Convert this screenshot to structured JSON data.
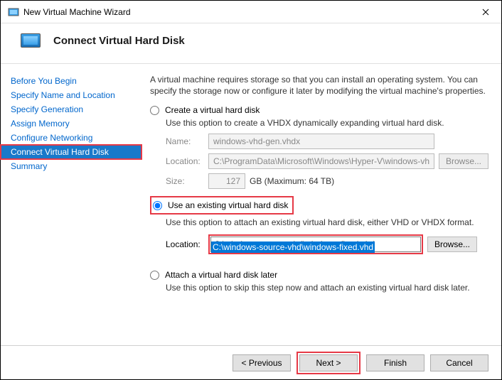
{
  "window": {
    "title": "New Virtual Machine Wizard"
  },
  "header": {
    "title": "Connect Virtual Hard Disk"
  },
  "sidebar": {
    "items": [
      {
        "label": "Before You Begin"
      },
      {
        "label": "Specify Name and Location"
      },
      {
        "label": "Specify Generation"
      },
      {
        "label": "Assign Memory"
      },
      {
        "label": "Configure Networking"
      },
      {
        "label": "Connect Virtual Hard Disk"
      },
      {
        "label": "Summary"
      }
    ],
    "active_index": 5
  },
  "content": {
    "intro": "A virtual machine requires storage so that you can install an operating system. You can specify the storage now or configure it later by modifying the virtual machine's properties.",
    "opt_create": {
      "label": "Create a virtual hard disk",
      "desc": "Use this option to create a VHDX dynamically expanding virtual hard disk.",
      "name_label": "Name:",
      "name_value": "windows-vhd-gen.vhdx",
      "location_label": "Location:",
      "location_value": "C:\\ProgramData\\Microsoft\\Windows\\Hyper-V\\windows-vhd-gen\\Vir",
      "browse_label": "Browse...",
      "size_label": "Size:",
      "size_value": "127",
      "size_unit": "GB (Maximum: 64 TB)"
    },
    "opt_existing": {
      "label": "Use an existing virtual hard disk",
      "desc": "Use this option to attach an existing virtual hard disk, either VHD or VHDX format.",
      "location_label": "Location:",
      "location_value": "C:\\windows-source-vhd\\windows-fixed.vhd",
      "browse_label": "Browse..."
    },
    "opt_later": {
      "label": "Attach a virtual hard disk later",
      "desc": "Use this option to skip this step now and attach an existing virtual hard disk later."
    }
  },
  "footer": {
    "previous": "< Previous",
    "next": "Next >",
    "finish": "Finish",
    "cancel": "Cancel"
  }
}
